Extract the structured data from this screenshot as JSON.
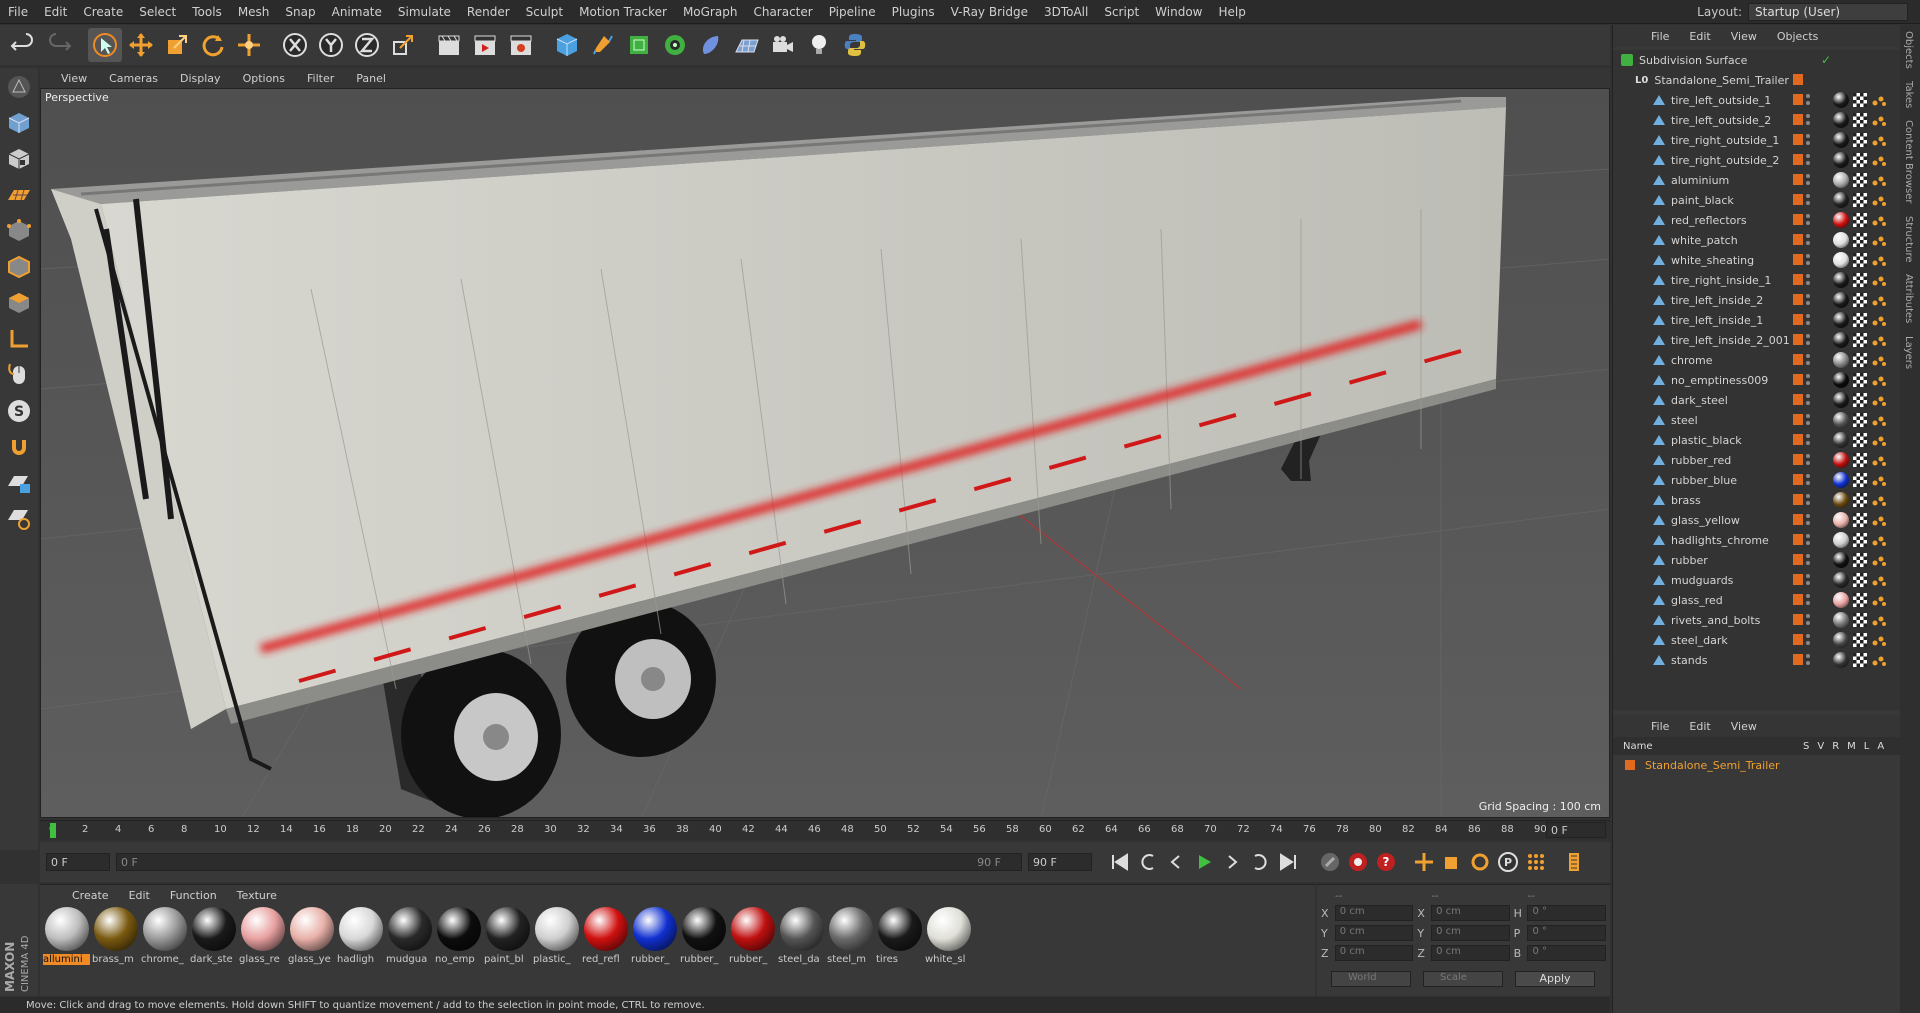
{
  "menubar": {
    "items": [
      "File",
      "Edit",
      "Create",
      "Select",
      "Tools",
      "Mesh",
      "Snap",
      "Animate",
      "Simulate",
      "Render",
      "Sculpt",
      "Motion Tracker",
      "MoGraph",
      "Character",
      "Pipeline",
      "Plugins",
      "V-Ray Bridge",
      "3DToAll",
      "Script",
      "Window",
      "Help"
    ],
    "layout_label": "Layout:",
    "layout_value": "Startup (User)"
  },
  "viewport": {
    "menu": [
      "View",
      "Cameras",
      "Display",
      "Options",
      "Filter",
      "Panel"
    ],
    "label": "Perspective",
    "grid_spacing": "Grid Spacing : 100 cm"
  },
  "timeline": {
    "ticks": [
      0,
      2,
      4,
      6,
      8,
      10,
      12,
      14,
      16,
      18,
      20,
      22,
      24,
      26,
      28,
      30,
      32,
      34,
      36,
      38,
      40,
      42,
      44,
      46,
      48,
      50,
      52,
      54,
      56,
      58,
      60,
      62,
      64,
      66,
      68,
      70,
      72,
      74,
      76,
      78,
      80,
      82,
      84,
      86,
      88,
      90
    ],
    "end_field": "0 F"
  },
  "playbar": {
    "start": "0 F",
    "range_start": "0 F",
    "range_end": "90 F",
    "end": "90 F"
  },
  "materials": {
    "menu": [
      "Create",
      "Edit",
      "Function",
      "Texture"
    ],
    "items": [
      {
        "label": "allumini",
        "color": "#bdbdbd"
      },
      {
        "label": "brass_m",
        "color": "#7a5a10"
      },
      {
        "label": "chrome_",
        "color": "#9a9a9a"
      },
      {
        "label": "dark_ste",
        "color": "#1a1a1a"
      },
      {
        "label": "glass_re",
        "color": "#e8a0a0"
      },
      {
        "label": "glass_ye",
        "color": "#e8b0a8"
      },
      {
        "label": "hadligh",
        "color": "#d8d8d8"
      },
      {
        "label": "mudgua",
        "color": "#2a2a2a"
      },
      {
        "label": "no_emp",
        "color": "#0c0c0c"
      },
      {
        "label": "paint_bl",
        "color": "#222222"
      },
      {
        "label": "plastic_",
        "color": "#cfcfcf"
      },
      {
        "label": "red_refl",
        "color": "#d01010"
      },
      {
        "label": "rubber_",
        "color": "#1030d0"
      },
      {
        "label": "rubber_",
        "color": "#111111"
      },
      {
        "label": "rubber_",
        "color": "#c01010"
      },
      {
        "label": "steel_da",
        "color": "#555555"
      },
      {
        "label": "steel_m",
        "color": "#6a6a6a"
      },
      {
        "label": "tires",
        "color": "#1a1a1a"
      },
      {
        "label": "white_sl",
        "color": "#e0e0d8"
      }
    ]
  },
  "coords": {
    "header": [
      "--",
      "--",
      "--"
    ],
    "rows": [
      {
        "a": "X",
        "av": "0 cm",
        "b": "X",
        "bv": "0 cm",
        "c": "H",
        "cv": "0 °"
      },
      {
        "a": "Y",
        "av": "0 cm",
        "b": "Y",
        "bv": "0 cm",
        "c": "P",
        "cv": "0 °"
      },
      {
        "a": "Z",
        "av": "0 cm",
        "b": "Z",
        "bv": "0 cm",
        "c": "B",
        "cv": "0 °"
      }
    ],
    "world": "World",
    "scale": "Scale",
    "apply": "Apply"
  },
  "status": "Move: Click and drag to move elements. Hold down SHIFT to quantize movement / add to the selection in point mode, CTRL to remove.",
  "objects": {
    "menu": [
      "File",
      "Edit",
      "View",
      "Objects"
    ],
    "root": "Subdivision Surface",
    "group": "Standalone_Semi_Trailer",
    "children": [
      {
        "name": "tire_left_outside_1",
        "color": "#1a1a1a"
      },
      {
        "name": "tire_left_outside_2",
        "color": "#1a1a1a"
      },
      {
        "name": "tire_right_outside_1",
        "color": "#1a1a1a"
      },
      {
        "name": "tire_right_outside_2",
        "color": "#1a1a1a"
      },
      {
        "name": "aluminium",
        "color": "#aaaaaa"
      },
      {
        "name": "paint_black",
        "color": "#222222"
      },
      {
        "name": "red_reflectors",
        "color": "#d01010"
      },
      {
        "name": "white_patch",
        "color": "#dddddd"
      },
      {
        "name": "white_sheating",
        "color": "#e0e0e0"
      },
      {
        "name": "tire_right_inside_1",
        "color": "#1a1a1a"
      },
      {
        "name": "tire_left_inside_2",
        "color": "#1a1a1a"
      },
      {
        "name": "tire_left_inside_1",
        "color": "#1a1a1a"
      },
      {
        "name": "tire_left_inside_2_001",
        "color": "#1a1a1a"
      },
      {
        "name": "chrome",
        "color": "#888888"
      },
      {
        "name": "no_emptiness009",
        "color": "#0c0c0c"
      },
      {
        "name": "dark_steel",
        "color": "#1a1a1a"
      },
      {
        "name": "steel",
        "color": "#555555"
      },
      {
        "name": "plastic_black",
        "color": "#333333"
      },
      {
        "name": "rubber_red",
        "color": "#c01010"
      },
      {
        "name": "rubber_blue",
        "color": "#1030d0"
      },
      {
        "name": "brass",
        "color": "#6a4a10"
      },
      {
        "name": "glass_yellow",
        "color": "#e8b0a8"
      },
      {
        "name": "hadlights_chrome",
        "color": "#cccccc"
      },
      {
        "name": "rubber",
        "color": "#111111"
      },
      {
        "name": "mudguards",
        "color": "#2a2a2a"
      },
      {
        "name": "glass_red",
        "color": "#e8a0a0"
      },
      {
        "name": "rivets_and_bolts",
        "color": "#777777"
      },
      {
        "name": "steel_dark",
        "color": "#444444"
      },
      {
        "name": "stands",
        "color": "#333333"
      }
    ]
  },
  "layers": {
    "menu": [
      "File",
      "Edit",
      "View"
    ],
    "header_name": "Name",
    "header_cols": [
      "S",
      "V",
      "R",
      "M",
      "L",
      "A"
    ],
    "item": "Standalone_Semi_Trailer"
  },
  "side_tabs": [
    "Objects",
    "Takes",
    "Content Browser",
    "Structure",
    "Attributes",
    "Layers"
  ],
  "brand": {
    "maxon": "MAXON",
    "product": "CINEMA 4D"
  }
}
